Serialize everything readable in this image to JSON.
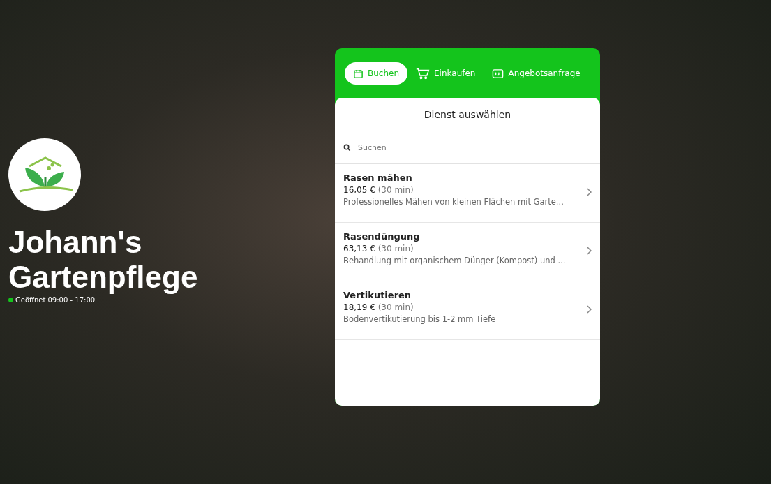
{
  "business": {
    "name_lines": [
      "Johann's",
      "Gartenpflege"
    ],
    "status": {
      "open": true,
      "hours": "Geöffnet 09:00 - 17:00"
    }
  },
  "widget": {
    "tabs": [
      {
        "label": "Buchen",
        "selected": true
      },
      {
        "label": "Einkaufen",
        "selected": false
      },
      {
        "label": "Angebotsanfrage",
        "selected": false
      }
    ],
    "heading": "Dienst auswählen",
    "search": {
      "placeholder": "Suchen"
    },
    "services": [
      {
        "name": "Rasen mähen",
        "price": "16,05 €",
        "duration": "(30 min)",
        "description": "Professionelles Mähen von kleinen Flächen mit Garte..."
      },
      {
        "name": "Rasendüngung",
        "price": "63,13 €",
        "duration": "(30 min)",
        "description": "Behandlung mit organischem Dünger (Kompost) und ..."
      },
      {
        "name": "Vertikutieren",
        "price": "18,19 €",
        "duration": "(30 min)",
        "description": "Bodenvertikutierung bis 1-2 mm Tiefe"
      }
    ]
  }
}
